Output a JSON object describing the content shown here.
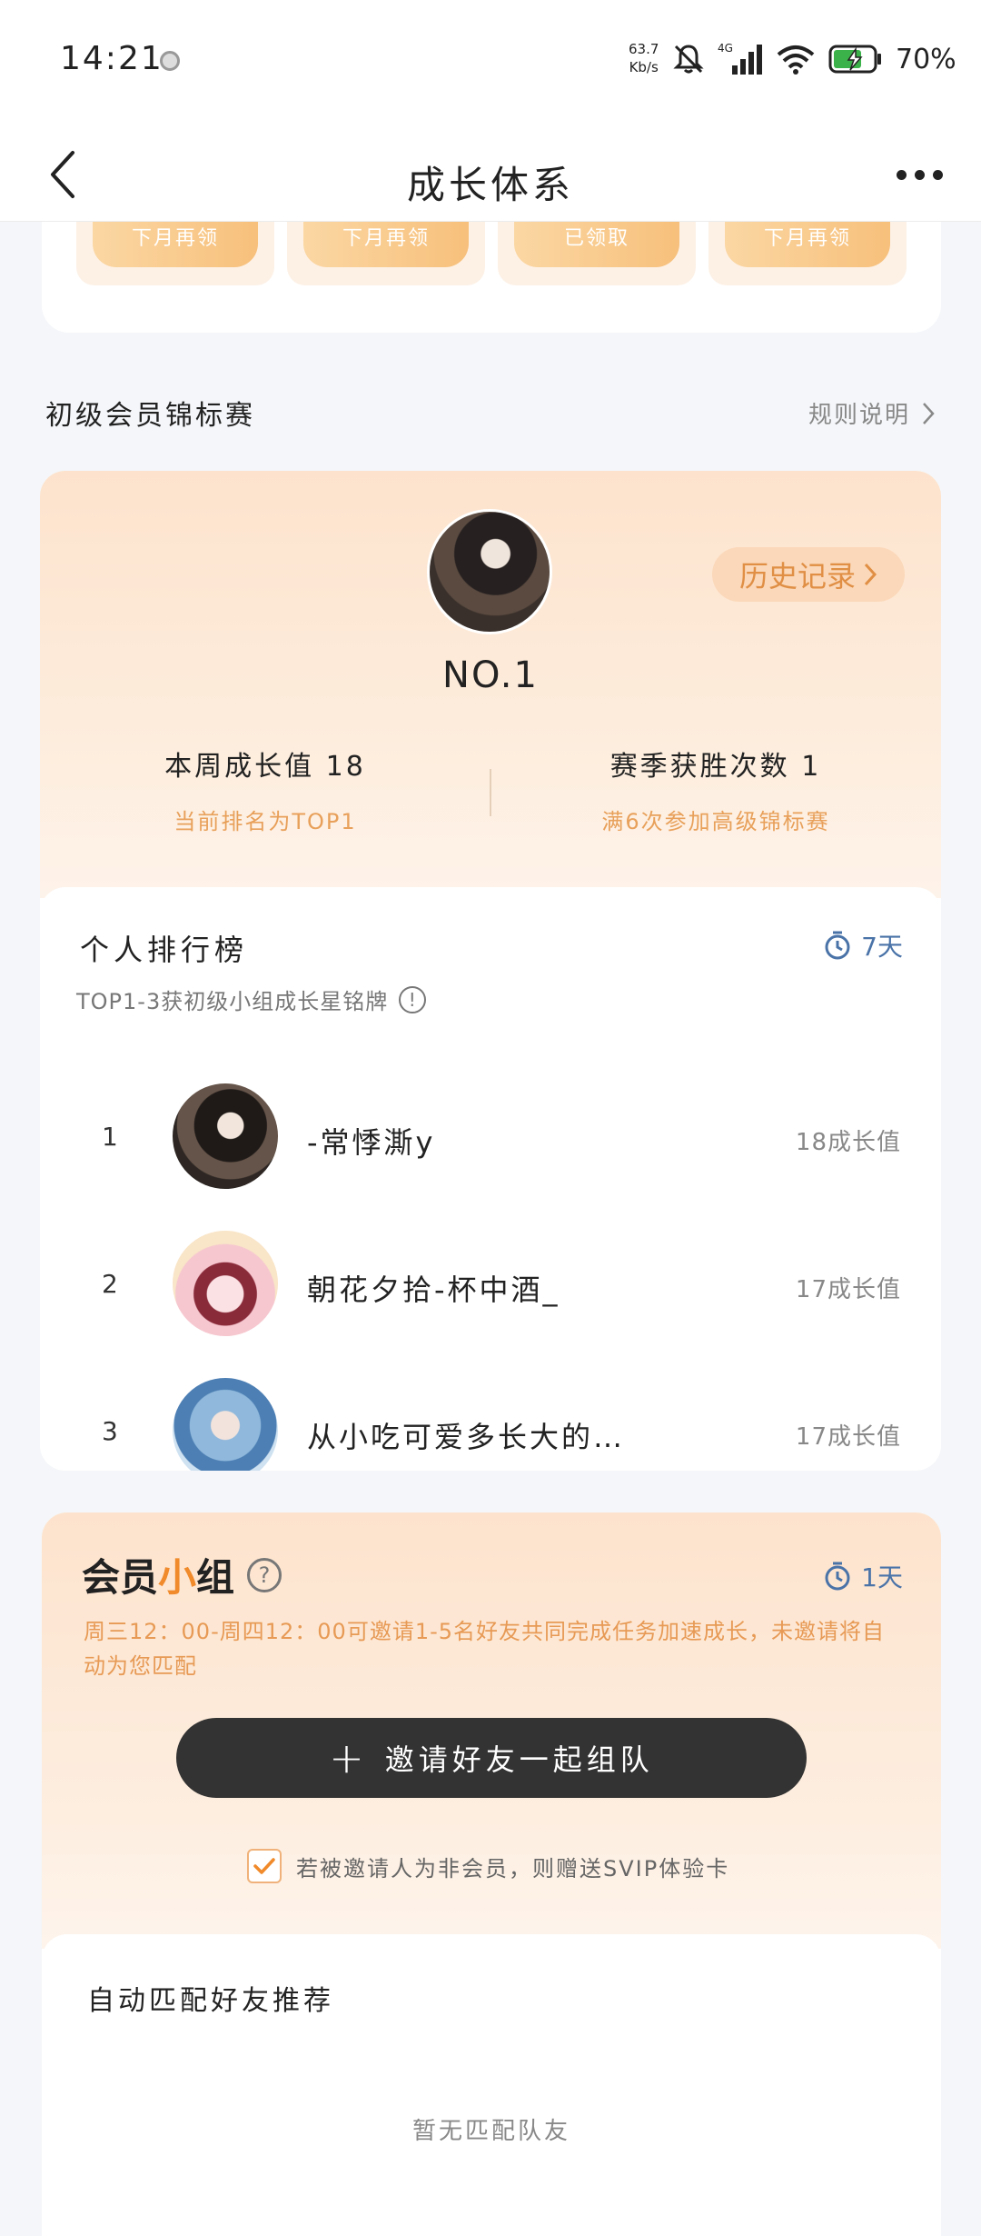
{
  "status_bar": {
    "time": "14:21",
    "net_speed_value": "63.7",
    "net_speed_unit": "Kb/s",
    "network_type": "4G",
    "battery": "70%"
  },
  "nav": {
    "title": "成长体系"
  },
  "rewards": {
    "buttons": [
      "下月再领",
      "下月再领",
      "已领取",
      "下月再领"
    ]
  },
  "championship": {
    "section_title": "初级会员锦标赛",
    "rules_label": "规则说明",
    "history_label": "历史记录",
    "my_rank": "NO.1",
    "weekly_growth": "本周成长值  18",
    "current_rank_note": "当前排名为TOP1",
    "season_wins": "赛季获胜次数  1",
    "advance_note": "满6次参加高级锦标赛"
  },
  "leaderboard": {
    "title": "个人排行榜",
    "timer": "7天",
    "description": "TOP1-3获初级小组成长星铭牌",
    "entries": [
      {
        "rank": "1",
        "name": "-常悸澌y",
        "score": "18成长值"
      },
      {
        "rank": "2",
        "name": "朝花夕拾-杯中酒_",
        "score": "17成长值"
      },
      {
        "rank": "3",
        "name": "从小吃可爱多长大的…",
        "score": "17成长值"
      }
    ]
  },
  "member_group": {
    "title_part1": "会员",
    "title_part2": "小",
    "title_part3": "组",
    "timer": "1天",
    "description": "周三12：00-周四12：00可邀请1-5名好友共同完成任务加速成长，未邀请将自动为您匹配",
    "invite_label": "邀请好友一起组队",
    "svip_note": "若被邀请人为非会员，则赠送SVIP体验卡",
    "svip_checked": true,
    "match_title": "自动匹配好友推荐",
    "match_empty": "暂无匹配队友"
  },
  "colors": {
    "accent_orange": "#f08a2a",
    "timer_blue": "#4a73a8",
    "note_orange": "#e8a05a"
  }
}
